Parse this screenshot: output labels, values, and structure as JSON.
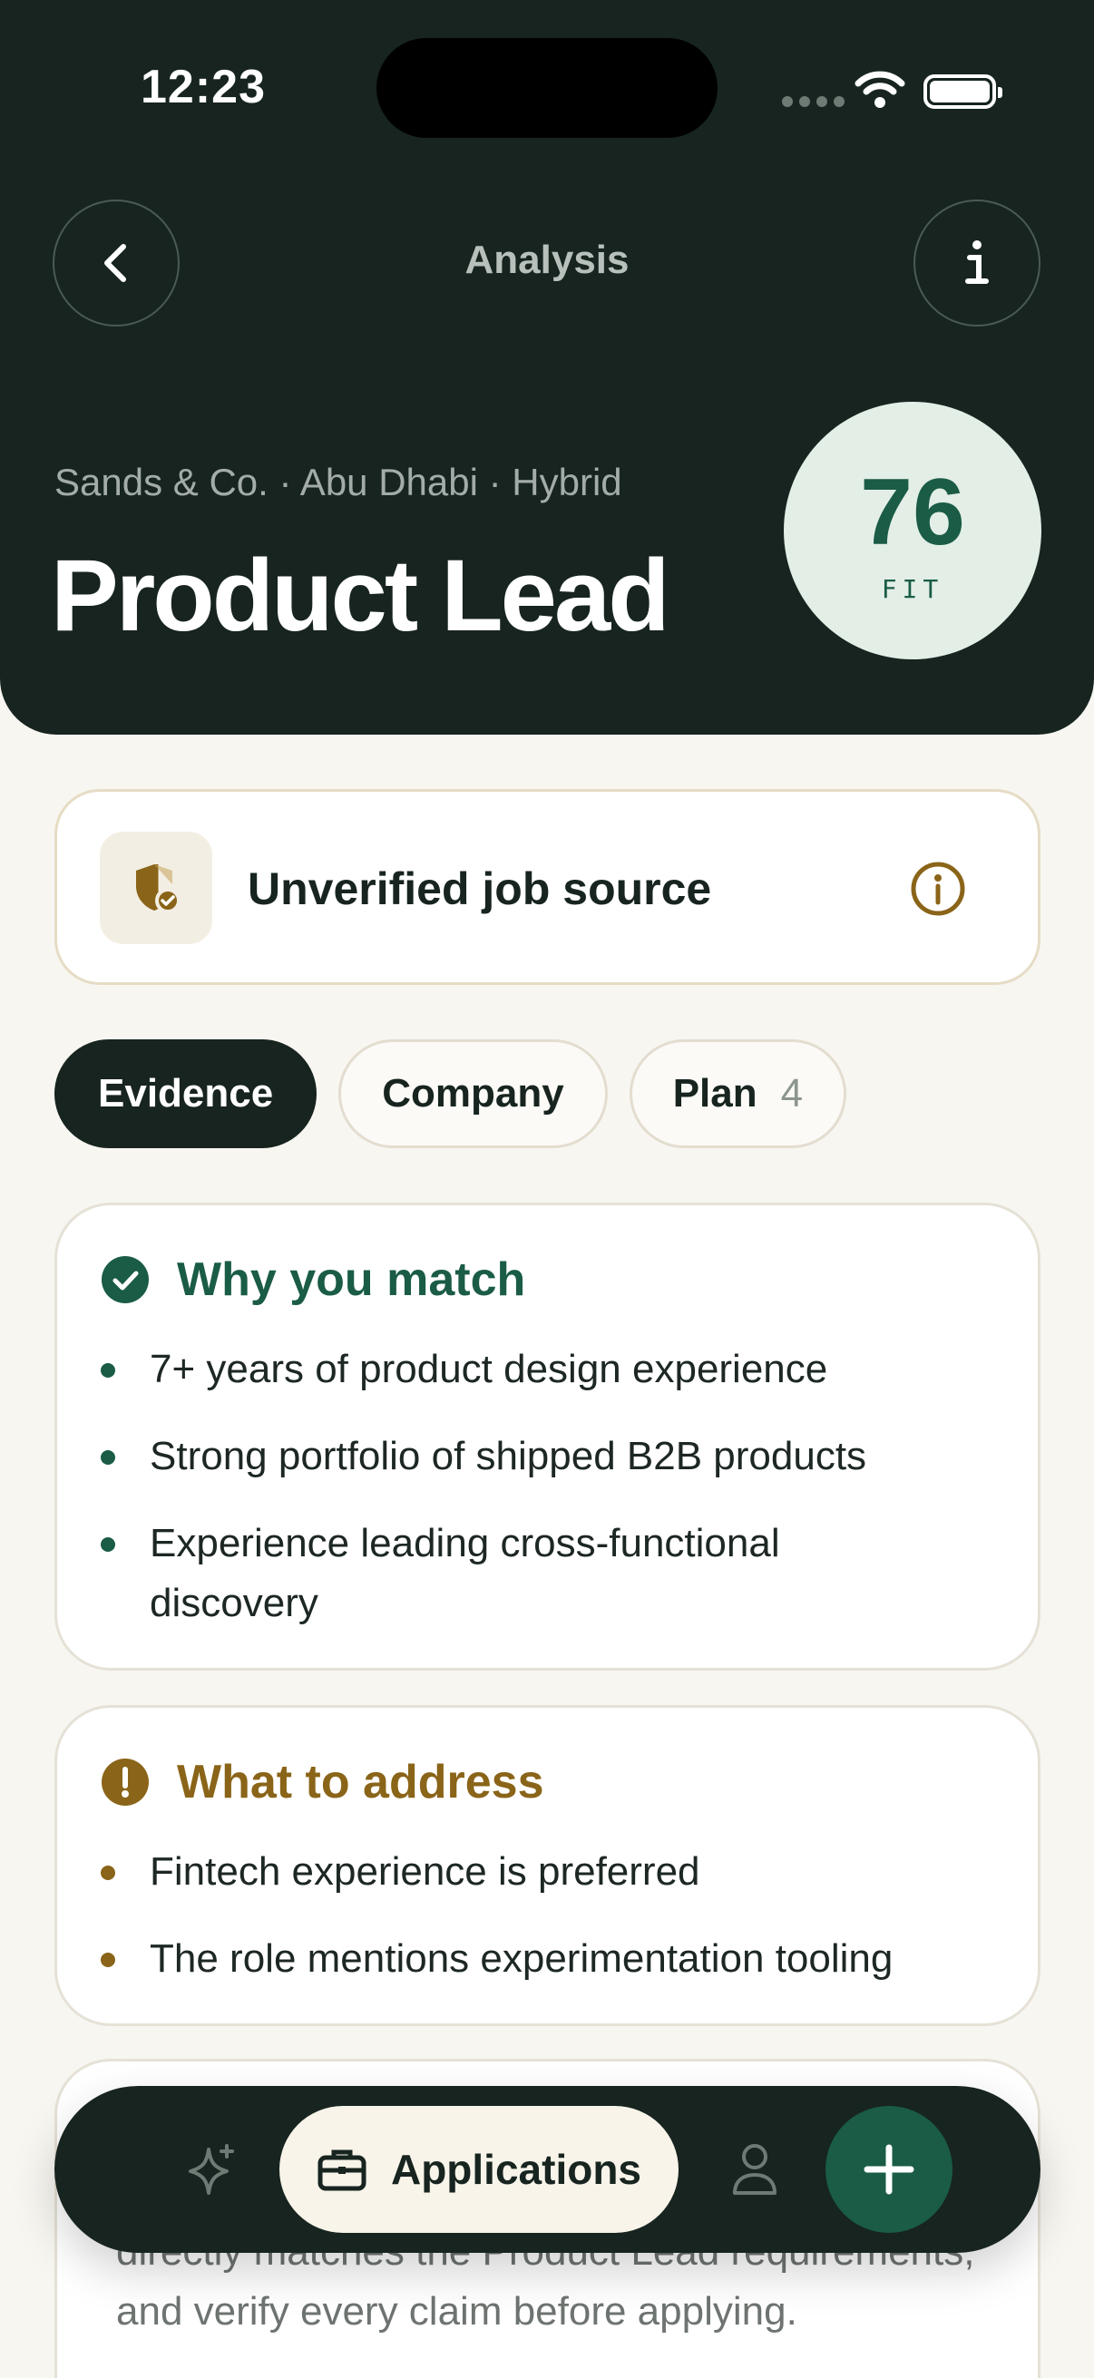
{
  "status_bar": {
    "time": "12:23"
  },
  "nav": {
    "title": "Analysis",
    "back_icon": "chevron-left-icon",
    "info_icon": "info-icon"
  },
  "job": {
    "meta": "Sands & Co. · Abu Dhabi · Hybrid",
    "title": "Product Lead",
    "fit_score": "76",
    "fit_label": "FIT"
  },
  "source_warning": {
    "text": "Unverified job source",
    "icon": "shield-check-icon"
  },
  "tabs": [
    {
      "label": "Evidence",
      "active": true
    },
    {
      "label": "Company",
      "active": false
    },
    {
      "label": "Plan",
      "count": "4",
      "active": false
    }
  ],
  "match": {
    "title": "Why you match",
    "items": [
      "7+ years of product design experience",
      "Strong portfolio of shipped B2B products",
      "Experience leading cross-functional discovery"
    ]
  },
  "address": {
    "title": "What to address",
    "items": [
      "Fintech experience is preferred",
      "The role mentions experimentation tooling"
    ]
  },
  "extra": {
    "text": "directly matches the Product Lead requirements, and verify every claim before applying."
  },
  "bottom_nav": {
    "active_label": "Applications",
    "colors": {
      "dark": "#17241f",
      "accent": "#1a5c46",
      "warning": "#8a6418"
    }
  }
}
